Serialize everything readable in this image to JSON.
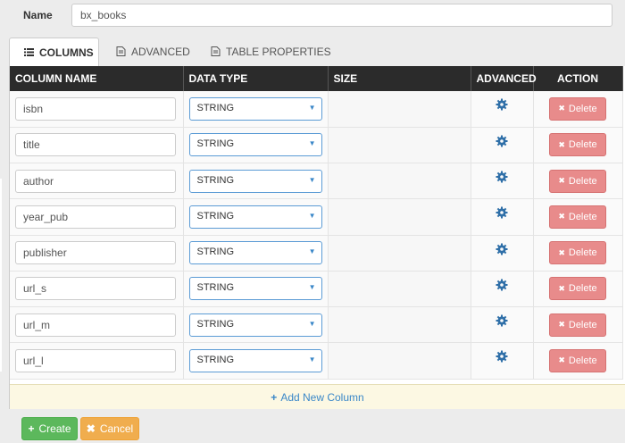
{
  "name": {
    "label": "Name",
    "value": "bx_books"
  },
  "tabs": [
    {
      "label": "COLUMNS",
      "icon": "list-icon",
      "active": true
    },
    {
      "label": "ADVANCED",
      "icon": "file-icon",
      "active": false
    },
    {
      "label": "TABLE PROPERTIES",
      "icon": "document-icon",
      "active": false
    }
  ],
  "table": {
    "headers": {
      "column_name": "COLUMN NAME",
      "data_type": "DATA TYPE",
      "size": "SIZE",
      "advanced": "ADVANCED",
      "action": "ACTION"
    },
    "rows": [
      {
        "name": "isbn",
        "type": "STRING"
      },
      {
        "name": "title",
        "type": "STRING"
      },
      {
        "name": "author",
        "type": "STRING"
      },
      {
        "name": "year_pub",
        "type": "STRING"
      },
      {
        "name": "publisher",
        "type": "STRING"
      },
      {
        "name": "url_s",
        "type": "STRING"
      },
      {
        "name": "url_m",
        "type": "STRING"
      },
      {
        "name": "url_l",
        "type": "STRING"
      }
    ],
    "delete_label": "Delete"
  },
  "add_column_label": "Add New Column",
  "buttons": {
    "create": "Create",
    "cancel": "Cancel"
  },
  "colors": {
    "header_bg": "#2b2b2b",
    "delete": "#e88b8b",
    "create": "#5cb85c",
    "cancel": "#f0ad4e",
    "accent": "#3a87c8",
    "add_row_bg": "#fcf8e3"
  }
}
